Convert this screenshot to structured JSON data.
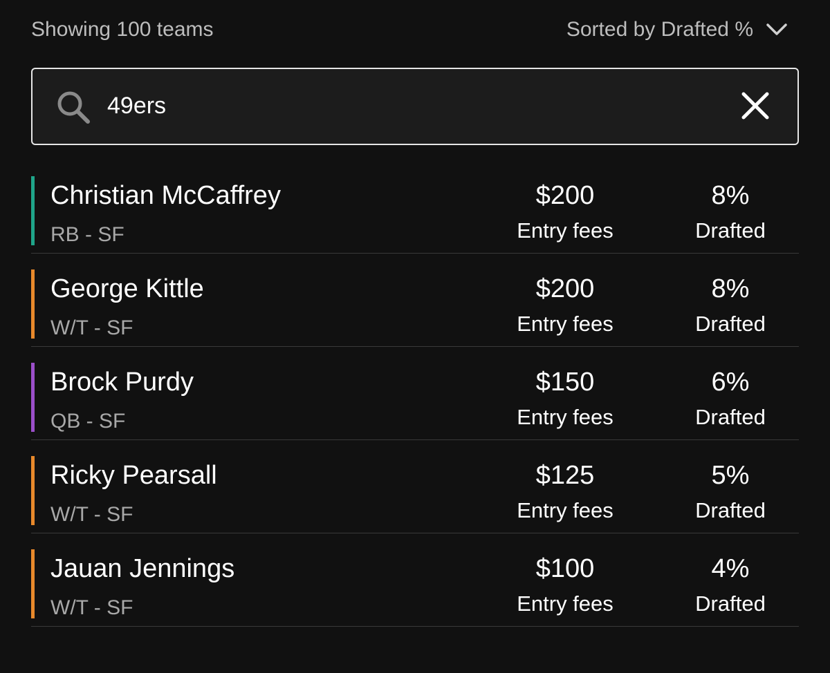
{
  "header": {
    "showing_text": "Showing 100 teams",
    "sort_label": "Sorted by Drafted %"
  },
  "search": {
    "value": "49ers",
    "placeholder": ""
  },
  "players": [
    {
      "name": "Christian McCaffrey",
      "position": "RB - SF",
      "entry_fee": "$200",
      "entry_fee_label": "Entry fees",
      "drafted": "8%",
      "drafted_label": "Drafted",
      "color": "#1fa58a"
    },
    {
      "name": "George Kittle",
      "position": "W/T - SF",
      "entry_fee": "$200",
      "entry_fee_label": "Entry fees",
      "drafted": "8%",
      "drafted_label": "Drafted",
      "color": "#e8892b"
    },
    {
      "name": "Brock Purdy",
      "position": "QB - SF",
      "entry_fee": "$150",
      "entry_fee_label": "Entry fees",
      "drafted": "6%",
      "drafted_label": "Drafted",
      "color": "#9b4fc9"
    },
    {
      "name": "Ricky Pearsall",
      "position": "W/T - SF",
      "entry_fee": "$125",
      "entry_fee_label": "Entry fees",
      "drafted": "5%",
      "drafted_label": "Drafted",
      "color": "#e8892b"
    },
    {
      "name": "Jauan Jennings",
      "position": "W/T - SF",
      "entry_fee": "$100",
      "entry_fee_label": "Entry fees",
      "drafted": "4%",
      "drafted_label": "Drafted",
      "color": "#e8892b"
    }
  ],
  "icons": {
    "search": "search-icon",
    "clear": "close-icon",
    "sort": "chevron-down-icon"
  }
}
